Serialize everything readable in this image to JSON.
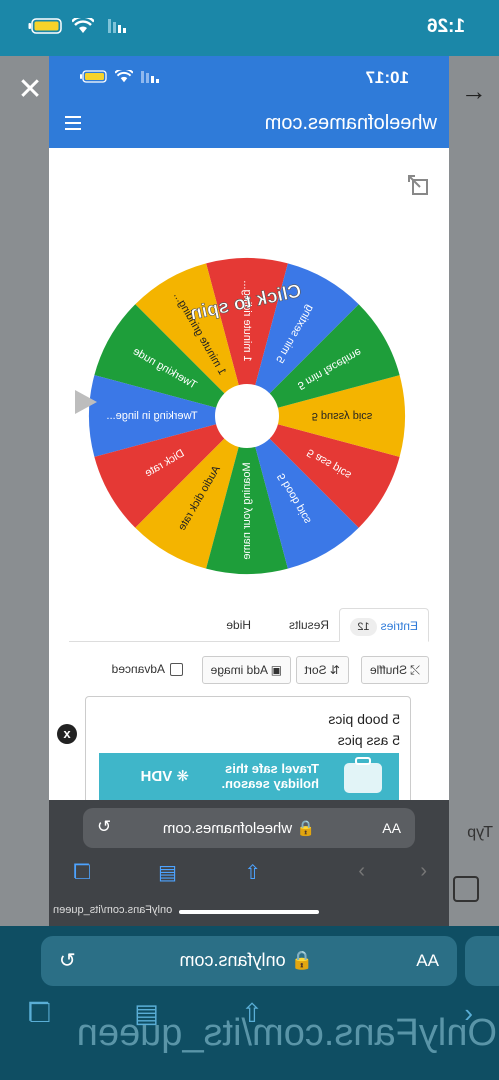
{
  "outer_status": {
    "time": "1:26",
    "location_arrow": "location-icon"
  },
  "inner_status": {
    "time": "10:17"
  },
  "app": {
    "site_title": "wheelofnames.com"
  },
  "wheel": {
    "center_label": "Click to spin",
    "segments": [
      {
        "label": "1 minute riding...",
        "color": "#e53935"
      },
      {
        "label": "1 minute grinding...",
        "color": "#f4b400"
      },
      {
        "label": "Twerking nude",
        "color": "#1e9e3a"
      },
      {
        "label": "Twerking in linge...",
        "color": "#3b78e7"
      },
      {
        "label": "Dick rate",
        "color": "#e53935"
      },
      {
        "label": "Audio dick rate",
        "color": "#f4b400"
      },
      {
        "label": "Moaning your name",
        "color": "#1e9e3a"
      },
      {
        "label": "5 boob pics",
        "color": "#3b78e7"
      },
      {
        "label": "5 ass pics",
        "color": "#e53935"
      },
      {
        "label": "5 pussy pics",
        "color": "#f4b400"
      },
      {
        "label": "5 min facetime",
        "color": "#1e9e3a"
      },
      {
        "label": "5 min sexting",
        "color": "#3b78e7"
      }
    ]
  },
  "tabs": {
    "entries": "Entries",
    "entries_count": "12",
    "results": "Results",
    "hide": "Hide"
  },
  "tools": {
    "shuffle": "Shuffle",
    "sort": "Sort",
    "add_image": "Add image",
    "advanced": "Advanced"
  },
  "entries_text": [
    "5 boob pics",
    "5 ass pics"
  ],
  "ad": {
    "line1": "Travel safe this",
    "line2": "holiday season.",
    "brand": "VDH"
  },
  "inner_safari": {
    "aa": "AA",
    "host": "wheelofnames.com",
    "link_preview": "onlyFans.com/its_queen"
  },
  "outer_safari": {
    "aa": "AA",
    "host": "onlyfans.com",
    "big_text": "OnlyFans.com/its_queen"
  },
  "backdrop": {
    "typ": "Typ"
  }
}
